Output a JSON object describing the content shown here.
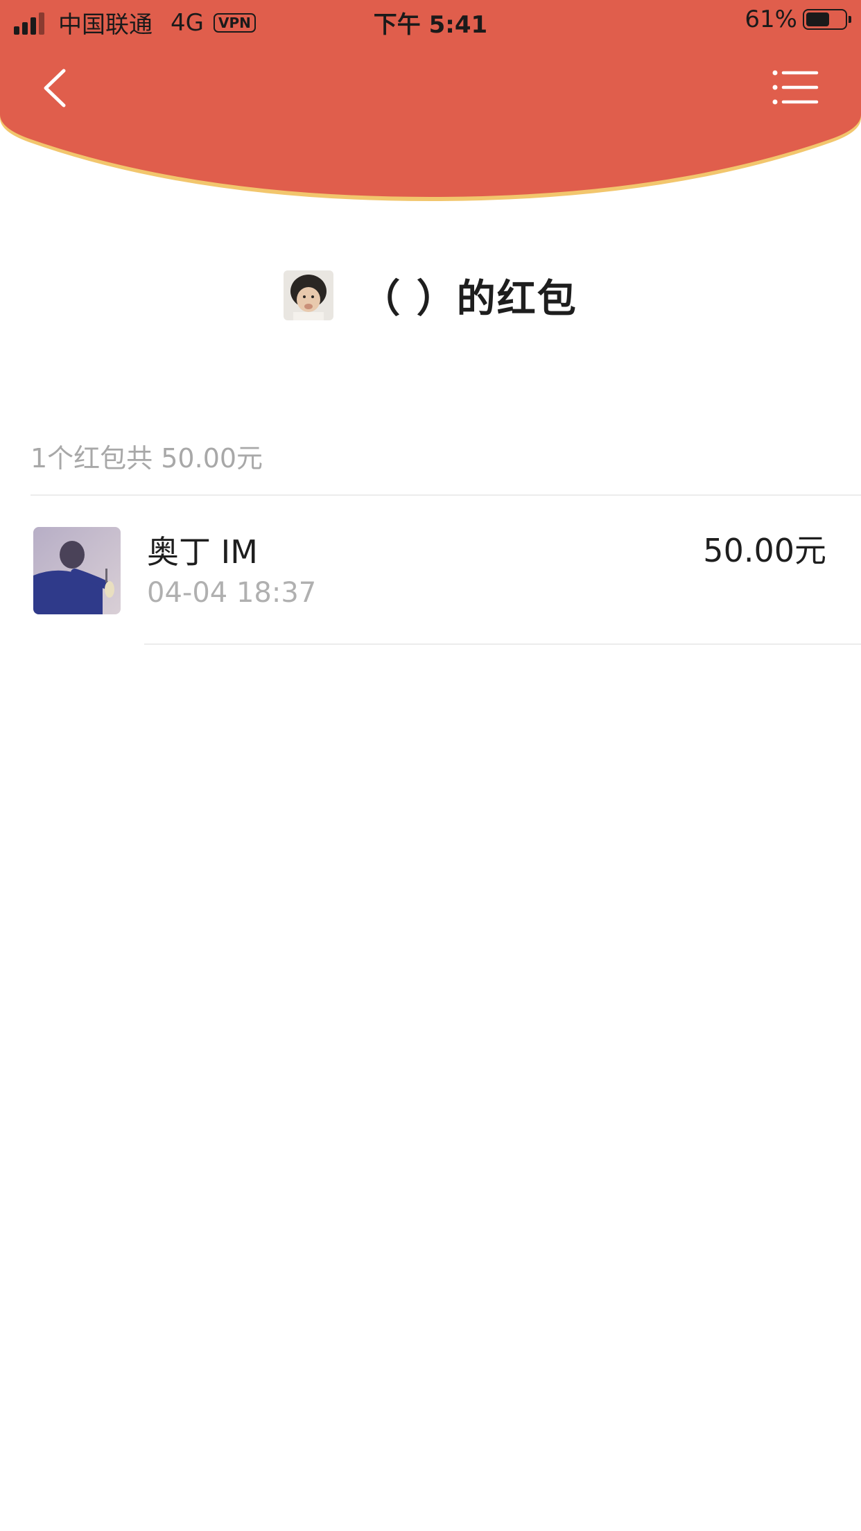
{
  "colors": {
    "header_red": "#E05E4C",
    "header_rim": "#F2C66D",
    "muted_text": "#A8A8A8"
  },
  "status_bar": {
    "carrier": "中国联通",
    "network": "4G",
    "vpn": "VPN",
    "time": "下午 5:41",
    "battery_percent": "61%",
    "battery_level": 0.61
  },
  "nav": {
    "back_icon": "chevron-left-icon",
    "menu_icon": "list-menu-icon"
  },
  "header": {
    "title": "（  ）的红包"
  },
  "summary": "1个红包共 50.00元",
  "records": [
    {
      "name": "奥丁 IM",
      "time": "04-04 18:37",
      "amount": "50.00元"
    }
  ]
}
